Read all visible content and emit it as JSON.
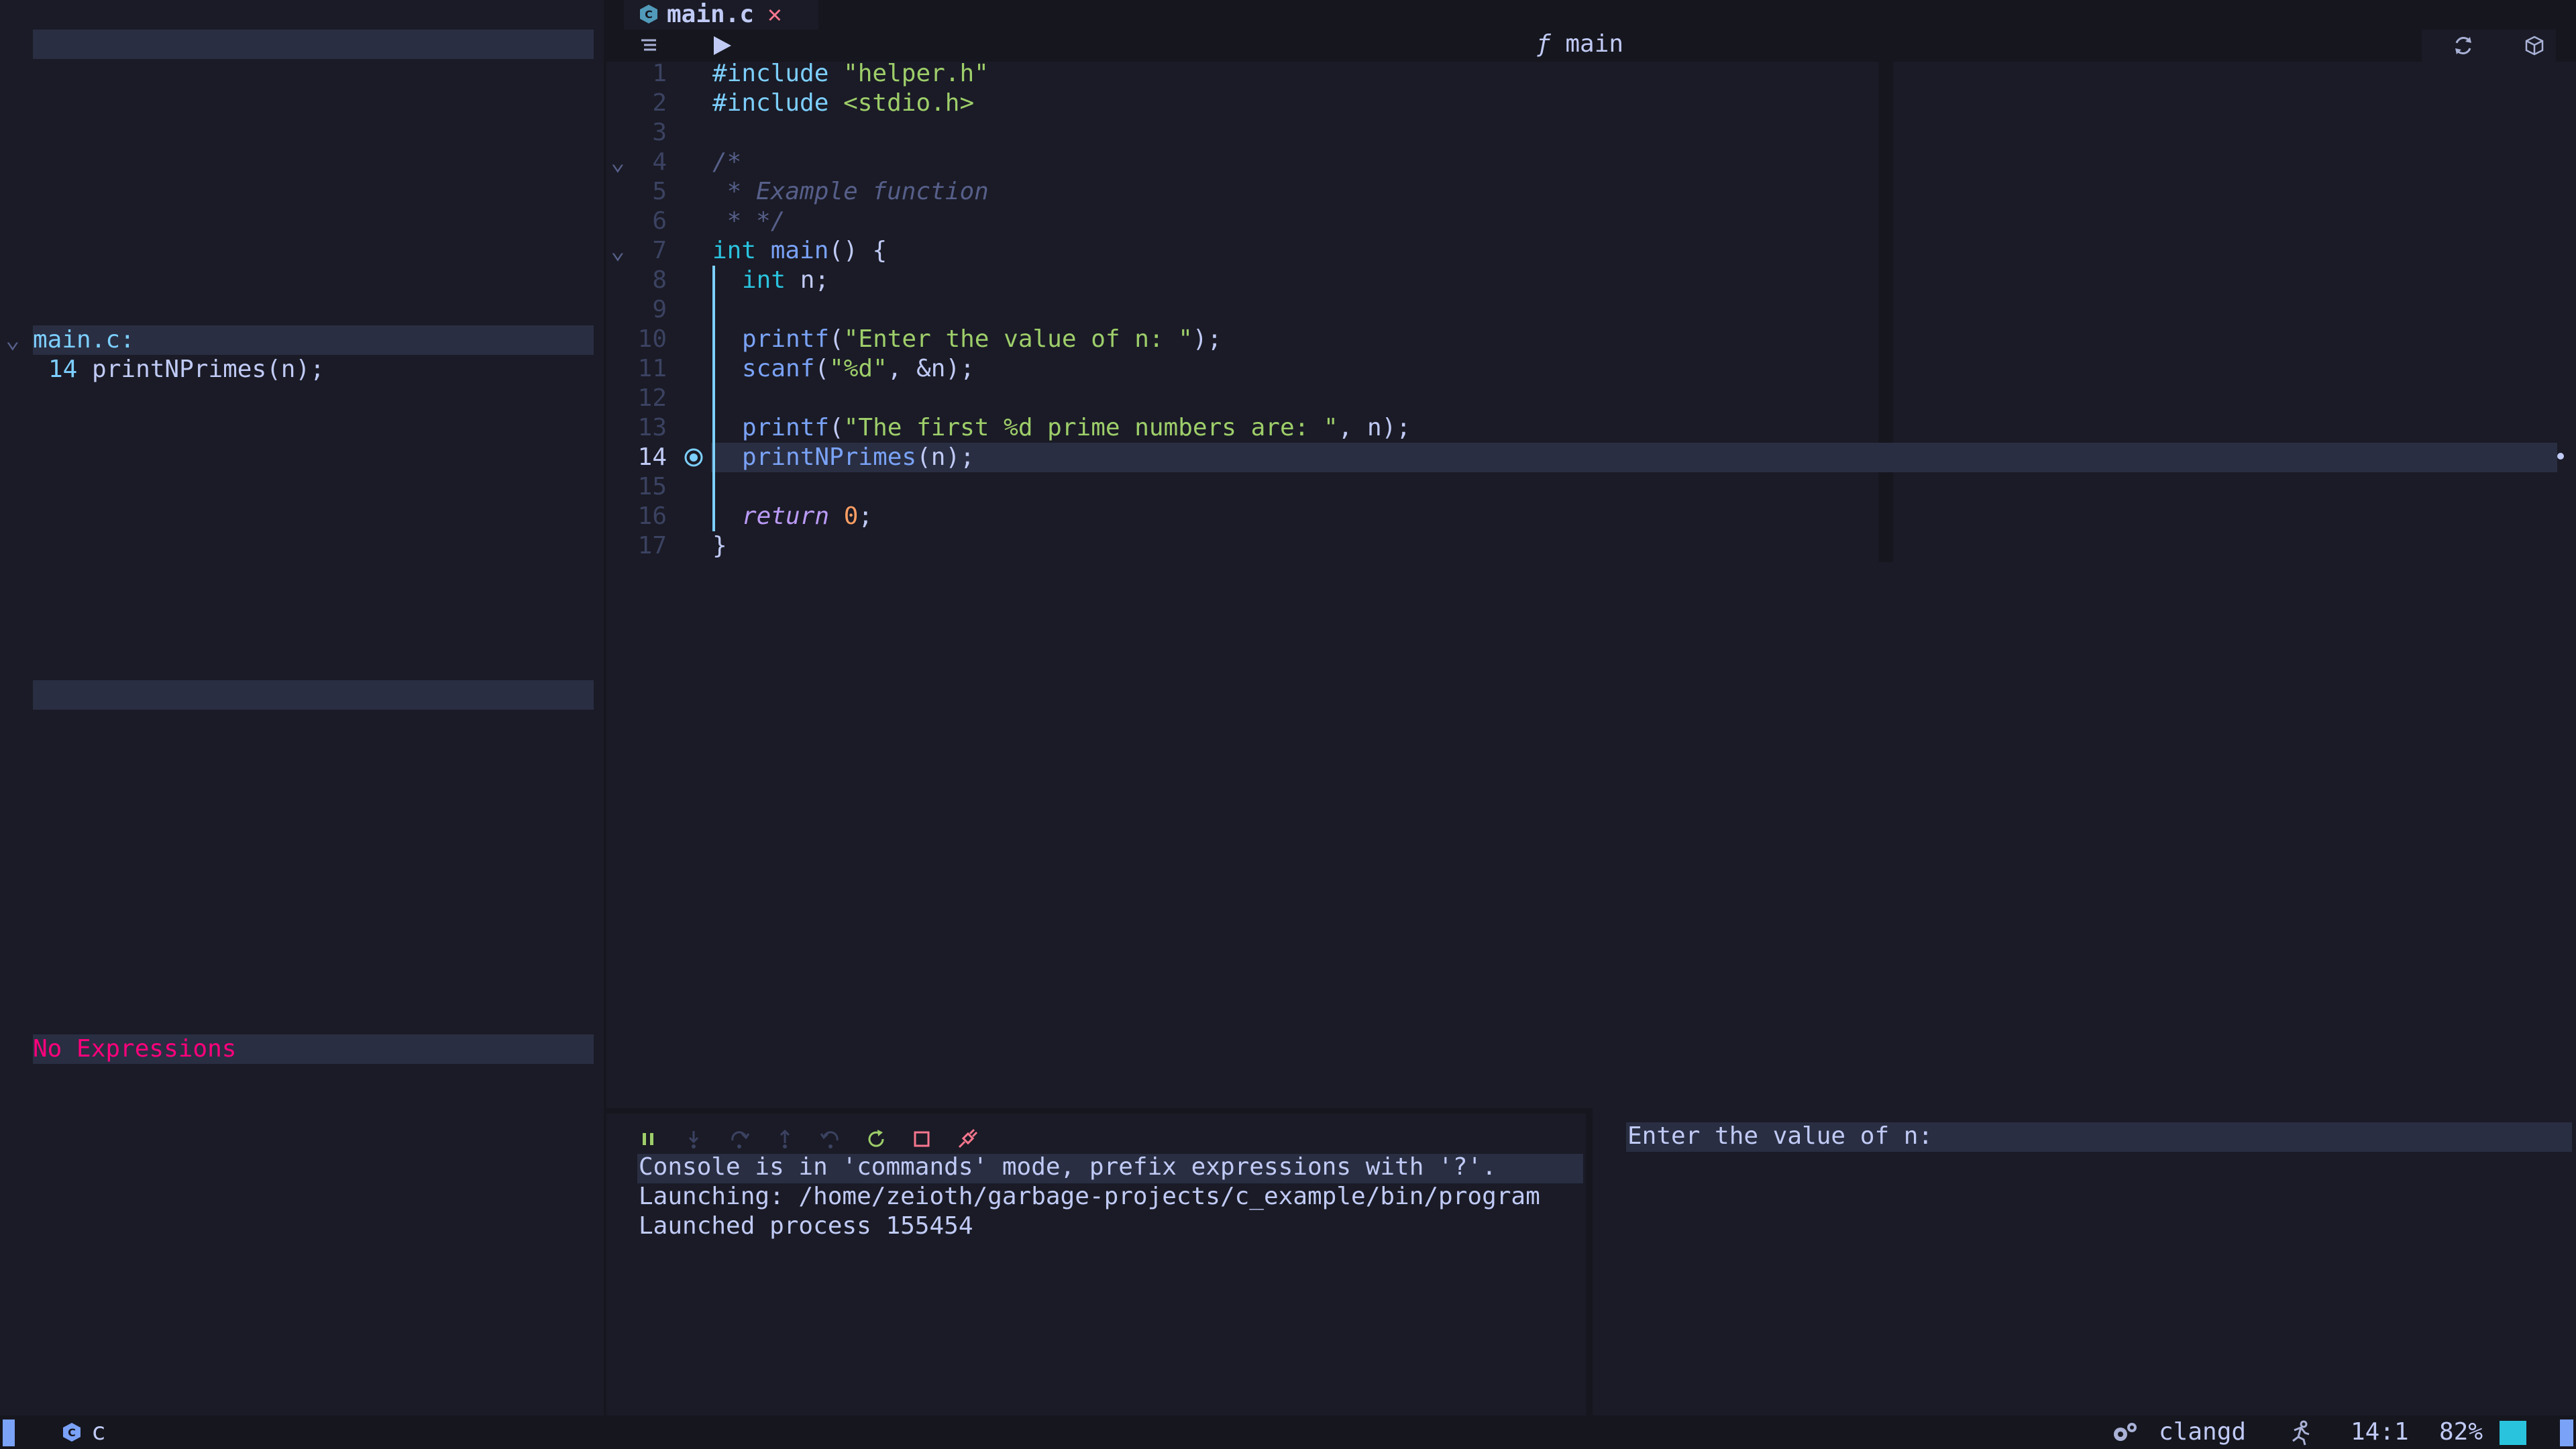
{
  "tab": {
    "icon": "c-file-icon",
    "filename": "main.c",
    "close": "✕"
  },
  "winbar": {
    "func_icon": "ƒ",
    "func_name": "main"
  },
  "stack": {
    "file": "main.c:",
    "frame_line": "14",
    "frame_call": "printNPrimes(n);"
  },
  "watches": {
    "empty_label": "No Expressions"
  },
  "code": {
    "line_numbers": [
      "1",
      "2",
      "3",
      "4",
      "5",
      "6",
      "7",
      "8",
      "9",
      "10",
      "11",
      "12",
      "13",
      "14",
      "15",
      "16",
      "17"
    ],
    "l1": {
      "directive": "#include",
      "target": "\"helper.h\""
    },
    "l2": {
      "directive": "#include",
      "target": "<stdio.h>"
    },
    "l4": "/*",
    "l5": " * Example function",
    "l6": " * */",
    "l7": {
      "type": "int",
      "name": "main",
      "rest": "() {"
    },
    "l8": {
      "type": "int",
      "rest": " n;"
    },
    "l10": {
      "fn": "printf",
      "open": "(",
      "str": "\"Enter the value of n: \"",
      "close": ");"
    },
    "l11": {
      "fn": "scanf",
      "open": "(",
      "str": "\"%d\"",
      "close": ", &n);"
    },
    "l13": {
      "fn": "printf",
      "open": "(",
      "str": "\"The first %d prime numbers are: \"",
      "close": ", n);"
    },
    "l14": {
      "fn": "printNPrimes",
      "rest": "(n);"
    },
    "l16": {
      "kw": "return",
      "num": "0",
      "rest": ";"
    },
    "l17": "}"
  },
  "console": {
    "lines": [
      "Console is in 'commands' mode, prefix expressions with '?'.",
      "Launching: /home/zeioth/garbage-projects/c_example/bin/program",
      "Launched process 155454"
    ]
  },
  "terminal": {
    "output": "Enter the value of n:"
  },
  "status": {
    "filetype": "c",
    "lsp": "clangd",
    "position": "14:1",
    "percent": "82%"
  },
  "colors": {
    "bg": "#1a1b26",
    "bg_dark": "#16161e",
    "highlight": "#292e42",
    "accent": "#7dcfff",
    "blue": "#7aa2f7",
    "red": "#f7768e",
    "green": "#9ece6a",
    "error": "#ff007c"
  }
}
